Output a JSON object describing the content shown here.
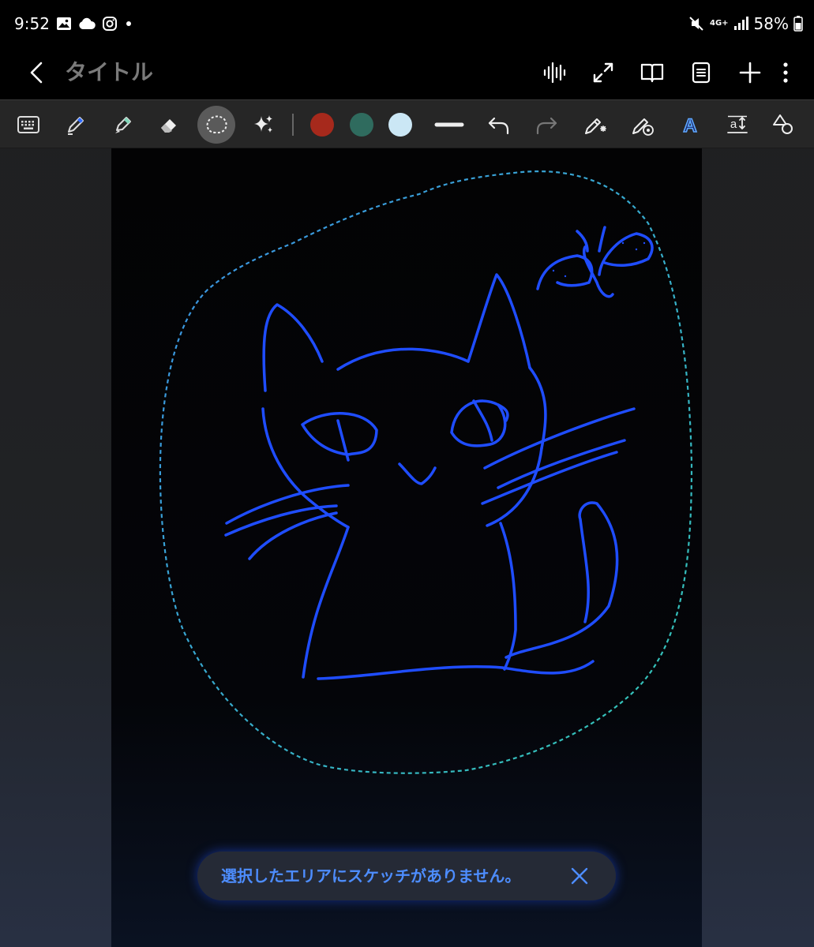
{
  "status_bar": {
    "time": "9:52",
    "left_icons": [
      "gallery-icon",
      "cloud-icon",
      "instagram-icon",
      "dot-icon"
    ],
    "network": "4G+",
    "battery": "58%"
  },
  "app_bar": {
    "title": "タイトル",
    "actions": [
      "voice-recording-icon",
      "expand-icon",
      "book-view-icon",
      "page-layout-icon",
      "add-icon",
      "more-options-icon"
    ]
  },
  "toolbar": {
    "tools": [
      "keyboard",
      "pen",
      "highlighter",
      "eraser",
      "lasso-select",
      "ai-sparkle"
    ],
    "active_tool": "lasso-select",
    "colors": [
      "#a6291c",
      "#2f6b5e",
      "#cbe7f5"
    ],
    "right_tools": [
      "stroke-width",
      "undo",
      "redo",
      "pen-effects",
      "shape-pen",
      "text-style",
      "text-size",
      "shapes"
    ]
  },
  "canvas": {
    "stroke_color": "#1f4dff",
    "selection_colors": [
      "#3b8fe6",
      "#33c7b3"
    ]
  },
  "toast": {
    "message": "選択したエリアにスケッチがありません。",
    "color": "#4d8dff"
  }
}
